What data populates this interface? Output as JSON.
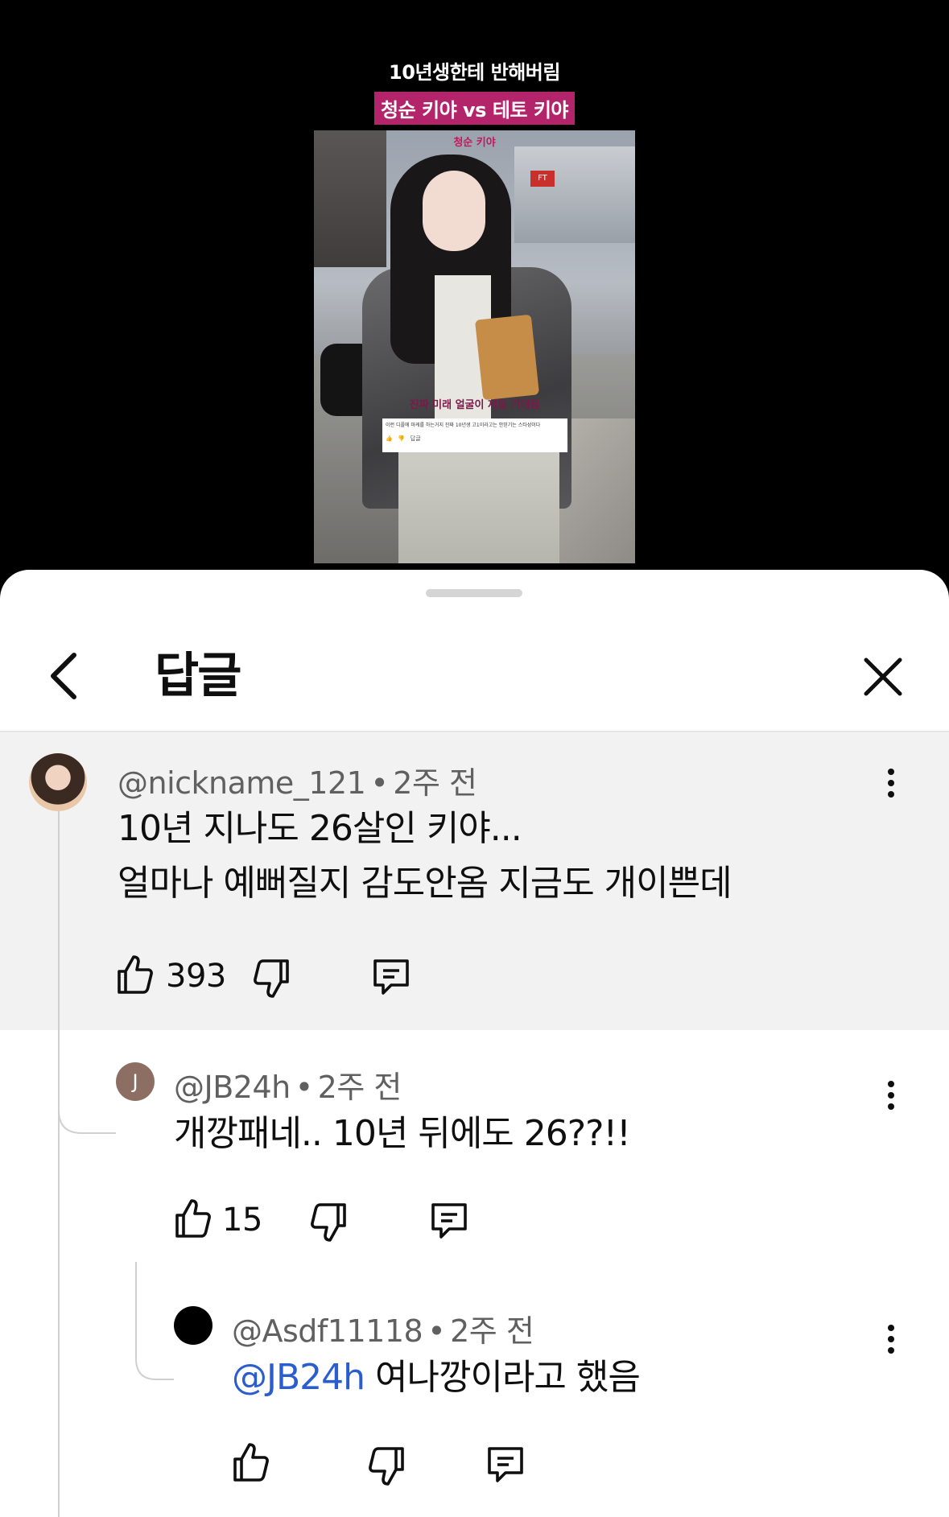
{
  "video": {
    "caption_line1": "10년생한테 반해버림",
    "caption_line2": "청순 키야 vs 테토 키야",
    "frame_label_top": "청순 키야",
    "frame_label_mid": "진짜 미래 얼굴이 제일 기대됨",
    "frame_mini_comment": "이런 디플에 마케를 하는거지 진짜 10년생 고1이라고는 안믿기는 스타성이다"
  },
  "sheet": {
    "title": "답글",
    "back_icon": "chevron-left-icon",
    "close_icon": "close-icon"
  },
  "comments": [
    {
      "username": "@nickname_121",
      "time": "2주 전",
      "lines": [
        "10년 지나도 26살인 키야...",
        "얼마나 예뻐질지 감도안옴 지금도 개이쁜데"
      ],
      "likes": "393",
      "avatar_letter": ""
    },
    {
      "username": "@JB24h",
      "time": "2주 전",
      "lines": [
        "개깡패네.. 10년 뒤에도 26??!!"
      ],
      "likes": "15",
      "avatar_letter": "J",
      "avatar_color": "#8d6e63"
    },
    {
      "username": "@Asdf11118",
      "time": "2주 전",
      "mention": "@JB24h",
      "text": " 여나깡이라고 했음",
      "likes": ""
    }
  ],
  "separator": "•",
  "colors": {
    "mention": "#2a5ecf",
    "highlight_bg": "#f2f2f2",
    "accent_caption": "#b3246b"
  }
}
